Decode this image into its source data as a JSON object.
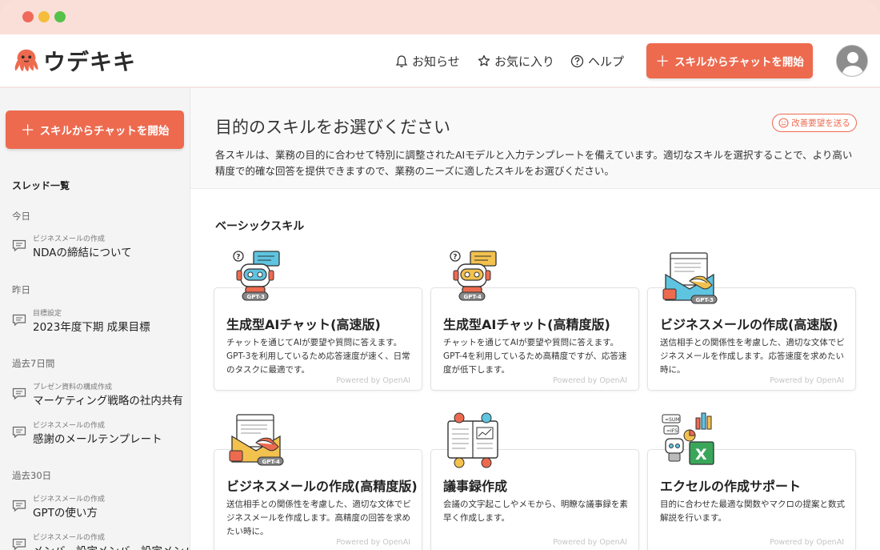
{
  "app": {
    "name": "ウデキキ"
  },
  "header": {
    "notifications_label": "お知らせ",
    "favorites_label": "お気に入り",
    "help_label": "ヘルプ",
    "cta_label": "スキルからチャットを開始"
  },
  "sidebar": {
    "cta_label": "スキルからチャットを開始",
    "heading": "スレッド一覧",
    "groups": [
      {
        "label": "今日",
        "threads": [
          {
            "category": "ビジネスメールの作成",
            "title": "NDAの締結について"
          }
        ]
      },
      {
        "label": "昨日",
        "threads": [
          {
            "category": "目標設定",
            "title": "2023年度下期 成果目標"
          }
        ]
      },
      {
        "label": "過去7日間",
        "threads": [
          {
            "category": "プレゼン資料の構成作成",
            "title": "マーケティング戦略の社内共有"
          },
          {
            "category": "ビジネスメールの作成",
            "title": "感謝のメールテンプレート"
          }
        ]
      },
      {
        "label": "過去30日",
        "threads": [
          {
            "category": "ビジネスメールの作成",
            "title": "GPTの使い方"
          },
          {
            "category": "ビジネスメールの作成",
            "title": "メンバー設定メンバー設定メンバー"
          }
        ]
      }
    ]
  },
  "main": {
    "title": "目的のスキルをお選びください",
    "feedback_label": "改善要望を送る",
    "description": "各スキルは、業務の目的に合わせて特別に調整されたAIモデルと入力テンプレートを備えています。適切なスキルを選択することで、より高い精度で的確な回答を提供できますので、業務のニーズに適したスキルをお選びください。",
    "section_title": "ベーシックスキル",
    "cards": [
      {
        "title": "生成型AIチャット(高速版)",
        "badge": "GPT-3",
        "description": "チャットを通じてAIが要望や質問に答えます。GPT-3を利用しているため応答速度が速く、日常のタスクに最適です。",
        "powered": "Powered by OpenAI"
      },
      {
        "title": "生成型AIチャット(高精度版)",
        "badge": "GPT-4",
        "description": "チャットを通じてAIが要望や質問に答えます。GPT-4を利用しているため高精度ですが、応答速度が低下します。",
        "powered": "Powered by OpenAI"
      },
      {
        "title": "ビジネスメールの作成(高速版)",
        "badge": "GPT-3",
        "description": "送信相手との関係性を考慮した、適切な文体でビジネスメールを作成します。応答速度を求めたい時に。",
        "powered": "Powered by OpenAI"
      },
      {
        "title": "ビジネスメールの作成(高精度版)",
        "badge": "GPT-4",
        "description": "送信相手との関係性を考慮した、適切な文体でビジネスメールを作成します。高精度の回答を求めたい時に。",
        "powered": "Powered by OpenAI"
      },
      {
        "title": "議事録作成",
        "badge": "",
        "description": "会議の文字起こしやメモから、明瞭な議事録を素早く作成します。",
        "powered": "Powered by OpenAI"
      },
      {
        "title": "エクセルの作成サポート",
        "badge": "",
        "description": "目的に合わせた最適な関数やマクロの提案と数式解説を行います。",
        "powered": "Powered by OpenAI"
      }
    ]
  },
  "colors": {
    "accent": "#ed6a4f",
    "window": "#fadfd8"
  }
}
